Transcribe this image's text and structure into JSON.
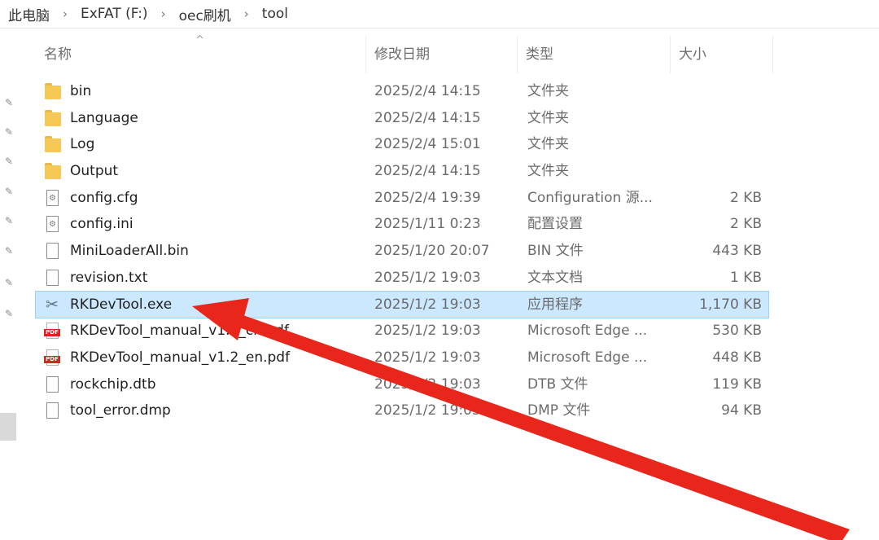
{
  "breadcrumb": [
    "此电脑",
    "ExFAT (F:)",
    "oec刷机",
    "tool"
  ],
  "breadcrumb_separator": "›",
  "columns": {
    "name": "名称",
    "date": "修改日期",
    "type": "类型",
    "size": "大小"
  },
  "sort_arrow": "^",
  "files": [
    {
      "name": "bin",
      "date": "2025/2/4 14:15",
      "type": "文件夹",
      "size": "",
      "icon": "folder-icon"
    },
    {
      "name": "Language",
      "date": "2025/2/4 14:15",
      "type": "文件夹",
      "size": "",
      "icon": "folder-icon"
    },
    {
      "name": "Log",
      "date": "2025/2/4 15:01",
      "type": "文件夹",
      "size": "",
      "icon": "folder-icon"
    },
    {
      "name": "Output",
      "date": "2025/2/4 14:15",
      "type": "文件夹",
      "size": "",
      "icon": "folder-icon"
    },
    {
      "name": "config.cfg",
      "date": "2025/2/4 19:39",
      "type": "Configuration 源...",
      "size": "2 KB",
      "icon": "config-file-icon"
    },
    {
      "name": "config.ini",
      "date": "2025/1/11 0:23",
      "type": "配置设置",
      "size": "2 KB",
      "icon": "settings-file-icon"
    },
    {
      "name": "MiniLoaderAll.bin",
      "date": "2025/1/20 20:07",
      "type": "BIN 文件",
      "size": "443 KB",
      "icon": "file-icon"
    },
    {
      "name": "revision.txt",
      "date": "2025/1/2 19:03",
      "type": "文本文档",
      "size": "1 KB",
      "icon": "text-file-icon"
    },
    {
      "name": "RKDevTool.exe",
      "date": "2025/1/2 19:03",
      "type": "应用程序",
      "size": "1,170 KB",
      "icon": "exe-tool-icon",
      "selected": true
    },
    {
      "name": "RKDevTool_manual_v1.2_cn.pdf",
      "date": "2025/1/2 19:03",
      "type": "Microsoft Edge ...",
      "size": "530 KB",
      "icon": "pdf-icon"
    },
    {
      "name": "RKDevTool_manual_v1.2_en.pdf",
      "date": "2025/1/2 19:03",
      "type": "Microsoft Edge ...",
      "size": "448 KB",
      "icon": "pdf-icon"
    },
    {
      "name": "rockchip.dtb",
      "date": "2025/1/2 19:03",
      "type": "DTB 文件",
      "size": "119 KB",
      "icon": "file-icon"
    },
    {
      "name": "tool_error.dmp",
      "date": "2025/1/2 19:03",
      "type": "DMP 文件",
      "size": "94 KB",
      "icon": "file-icon"
    }
  ],
  "icon_glyphs": {
    "pin": "✎",
    "tool": "✂",
    "doc_mark": "⚙"
  },
  "pdf_badge": "PDF",
  "colors": {
    "selection_bg": "#cce8ff",
    "selection_border": "#99d1ff",
    "folder": "#f5c954",
    "pdf": "#d7261f",
    "arrow": "#e8261c"
  }
}
